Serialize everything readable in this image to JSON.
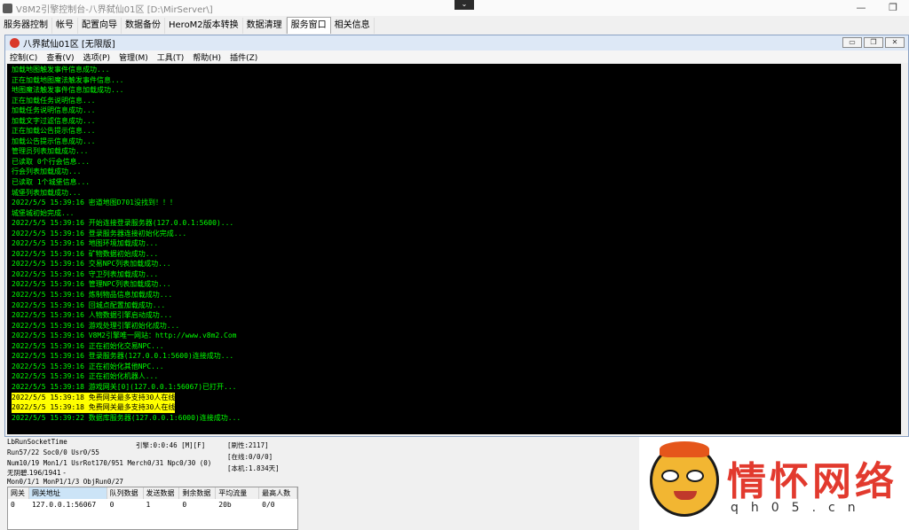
{
  "window": {
    "title": "V8M2引擎控制台-八界弑仙01区 [D:\\MirServer\\]",
    "drop_glyph": "⌄",
    "minimize": "—",
    "restore": "❐"
  },
  "top_tabs": [
    "服务器控制",
    "帐号",
    "配置向导",
    "数据备份",
    "HeroM2版本转换",
    "数据清理",
    "服务窗口",
    "相关信息"
  ],
  "active_tab": "服务窗口",
  "child_window": {
    "title": "八界弑仙01区 [无限版]",
    "controls": [
      "▭",
      "❐",
      "✕"
    ]
  },
  "menu": [
    "控制(C)",
    "查看(V)",
    "选项(P)",
    "管理(M)",
    "工具(T)",
    "帮助(H)",
    "插件(Z)"
  ],
  "console_lines": [
    "加载地图触发事件信息成功...",
    "正在加载地图魔法触发事件信息...",
    "地图魔法触发事件信息加载成功...",
    "正在加载任务说明信息...",
    "加载任务说明信息成功...",
    "加载文字过滤信息成功...",
    "正在加载公告提示信息...",
    "加载公告提示信息成功...",
    "管理员列表加载成功...",
    "已读取 0个行会信息...",
    "行会列表加载成功...",
    "已读取 1个城堡信息...",
    "城堡列表加载成功...",
    "2022/5/5 15:39:16 密道地图D701没找到！！！",
    "城堡城初始完成...",
    "2022/5/5 15:39:16 开始连接登录服务器(127.0.0.1:5600)...",
    "2022/5/5 15:39:16 登录服务器连接初始化完成...",
    "2022/5/5 15:39:16 地图环境加载成功...",
    "2022/5/5 15:39:16 矿物数据初始成功...",
    "2022/5/5 15:39:16 交易NPC列表加载成功...",
    "2022/5/5 15:39:16 守卫列表加载成功...",
    "2022/5/5 15:39:16 管理NPC列表加载成功...",
    "2022/5/5 15:39:16 炼制物品信息加载成功...",
    "2022/5/5 15:39:16 回城点配置加载成功...",
    "2022/5/5 15:39:16 人物数据引擎启动成功...",
    "2022/5/5 15:39:16 游戏处理引擎初始化成功...",
    "2022/5/5 15:39:16 V8M2引擎唯一网站：http://www.v8m2.Com",
    "2022/5/5 15:39:16 正在初始化交易NPC...",
    "2022/5/5 15:39:16 登录服务器(127.0.0.1:5600)连接成功...",
    "2022/5/5 15:39:16 正在初始化其他NPC...",
    "2022/5/5 15:39:16 正在初始化机器人...",
    "2022/5/5 15:39:18 游戏网关[0](127.0.0.1:56067)已打开...",
    "2022/5/5 15:39:18 免费网关最多支持30人在线",
    "2022/5/5 15:39:18 免费网关最多支持30人在线",
    "2022/5/5 15:39:22 数据库服务器(127.0.0.1:6000)连接成功..."
  ],
  "status": {
    "line1": "LbRunSocketTime",
    "line2": "Run57/22 Soc0/0 Usr0/55",
    "line3": "Num10/19 Mon1/1 UsrRot170/951 Merch0/31 Npc0/30 (0)",
    "line4": "无阴碧.196/1941 -",
    "line5": "Mon0/1/1 MonP1/1/3 ObjRun0/27",
    "engine": "引擎:0:0:46 [M][F]",
    "refresh": "[刷性:2117]",
    "online": "[在线:0/0/0]",
    "local": "[本机:1.834天]"
  },
  "table": {
    "headers": [
      "网关",
      "网关地址",
      "队列数据",
      "发送数据",
      "剩余数据",
      "平均流量",
      "最高人数"
    ],
    "rows": [
      [
        "0",
        "127.0.0.1:56067",
        "0",
        "1",
        "0",
        "20b",
        "0/0"
      ]
    ]
  },
  "ad": {
    "brand": "情怀网络",
    "domain": "qh05.cn"
  },
  "colors": {
    "console_text": "#00ff00",
    "console_bg": "#000000",
    "highlight_bg": "#ffff00",
    "brand_red": "#e23a2e"
  }
}
